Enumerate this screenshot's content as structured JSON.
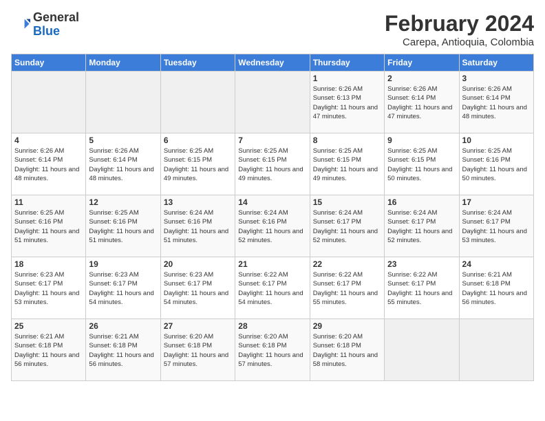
{
  "logo": {
    "general": "General",
    "blue": "Blue"
  },
  "title": "February 2024",
  "subtitle": "Carepa, Antioquia, Colombia",
  "days_of_week": [
    "Sunday",
    "Monday",
    "Tuesday",
    "Wednesday",
    "Thursday",
    "Friday",
    "Saturday"
  ],
  "weeks": [
    [
      {
        "day": "",
        "content": ""
      },
      {
        "day": "",
        "content": ""
      },
      {
        "day": "",
        "content": ""
      },
      {
        "day": "",
        "content": ""
      },
      {
        "day": "1",
        "content": "Sunrise: 6:26 AM\nSunset: 6:13 PM\nDaylight: 11 hours\nand 47 minutes."
      },
      {
        "day": "2",
        "content": "Sunrise: 6:26 AM\nSunset: 6:14 PM\nDaylight: 11 hours\nand 47 minutes."
      },
      {
        "day": "3",
        "content": "Sunrise: 6:26 AM\nSunset: 6:14 PM\nDaylight: 11 hours\nand 48 minutes."
      }
    ],
    [
      {
        "day": "4",
        "content": "Sunrise: 6:26 AM\nSunset: 6:14 PM\nDaylight: 11 hours\nand 48 minutes."
      },
      {
        "day": "5",
        "content": "Sunrise: 6:26 AM\nSunset: 6:14 PM\nDaylight: 11 hours\nand 48 minutes."
      },
      {
        "day": "6",
        "content": "Sunrise: 6:25 AM\nSunset: 6:15 PM\nDaylight: 11 hours\nand 49 minutes."
      },
      {
        "day": "7",
        "content": "Sunrise: 6:25 AM\nSunset: 6:15 PM\nDaylight: 11 hours\nand 49 minutes."
      },
      {
        "day": "8",
        "content": "Sunrise: 6:25 AM\nSunset: 6:15 PM\nDaylight: 11 hours\nand 49 minutes."
      },
      {
        "day": "9",
        "content": "Sunrise: 6:25 AM\nSunset: 6:15 PM\nDaylight: 11 hours\nand 50 minutes."
      },
      {
        "day": "10",
        "content": "Sunrise: 6:25 AM\nSunset: 6:16 PM\nDaylight: 11 hours\nand 50 minutes."
      }
    ],
    [
      {
        "day": "11",
        "content": "Sunrise: 6:25 AM\nSunset: 6:16 PM\nDaylight: 11 hours\nand 51 minutes."
      },
      {
        "day": "12",
        "content": "Sunrise: 6:25 AM\nSunset: 6:16 PM\nDaylight: 11 hours\nand 51 minutes."
      },
      {
        "day": "13",
        "content": "Sunrise: 6:24 AM\nSunset: 6:16 PM\nDaylight: 11 hours\nand 51 minutes."
      },
      {
        "day": "14",
        "content": "Sunrise: 6:24 AM\nSunset: 6:16 PM\nDaylight: 11 hours\nand 52 minutes."
      },
      {
        "day": "15",
        "content": "Sunrise: 6:24 AM\nSunset: 6:17 PM\nDaylight: 11 hours\nand 52 minutes."
      },
      {
        "day": "16",
        "content": "Sunrise: 6:24 AM\nSunset: 6:17 PM\nDaylight: 11 hours\nand 52 minutes."
      },
      {
        "day": "17",
        "content": "Sunrise: 6:24 AM\nSunset: 6:17 PM\nDaylight: 11 hours\nand 53 minutes."
      }
    ],
    [
      {
        "day": "18",
        "content": "Sunrise: 6:23 AM\nSunset: 6:17 PM\nDaylight: 11 hours\nand 53 minutes."
      },
      {
        "day": "19",
        "content": "Sunrise: 6:23 AM\nSunset: 6:17 PM\nDaylight: 11 hours\nand 54 minutes."
      },
      {
        "day": "20",
        "content": "Sunrise: 6:23 AM\nSunset: 6:17 PM\nDaylight: 11 hours\nand 54 minutes."
      },
      {
        "day": "21",
        "content": "Sunrise: 6:22 AM\nSunset: 6:17 PM\nDaylight: 11 hours\nand 54 minutes."
      },
      {
        "day": "22",
        "content": "Sunrise: 6:22 AM\nSunset: 6:17 PM\nDaylight: 11 hours\nand 55 minutes."
      },
      {
        "day": "23",
        "content": "Sunrise: 6:22 AM\nSunset: 6:17 PM\nDaylight: 11 hours\nand 55 minutes."
      },
      {
        "day": "24",
        "content": "Sunrise: 6:21 AM\nSunset: 6:18 PM\nDaylight: 11 hours\nand 56 minutes."
      }
    ],
    [
      {
        "day": "25",
        "content": "Sunrise: 6:21 AM\nSunset: 6:18 PM\nDaylight: 11 hours\nand 56 minutes."
      },
      {
        "day": "26",
        "content": "Sunrise: 6:21 AM\nSunset: 6:18 PM\nDaylight: 11 hours\nand 56 minutes."
      },
      {
        "day": "27",
        "content": "Sunrise: 6:20 AM\nSunset: 6:18 PM\nDaylight: 11 hours\nand 57 minutes."
      },
      {
        "day": "28",
        "content": "Sunrise: 6:20 AM\nSunset: 6:18 PM\nDaylight: 11 hours\nand 57 minutes."
      },
      {
        "day": "29",
        "content": "Sunrise: 6:20 AM\nSunset: 6:18 PM\nDaylight: 11 hours\nand 58 minutes."
      },
      {
        "day": "",
        "content": ""
      },
      {
        "day": "",
        "content": ""
      }
    ]
  ]
}
